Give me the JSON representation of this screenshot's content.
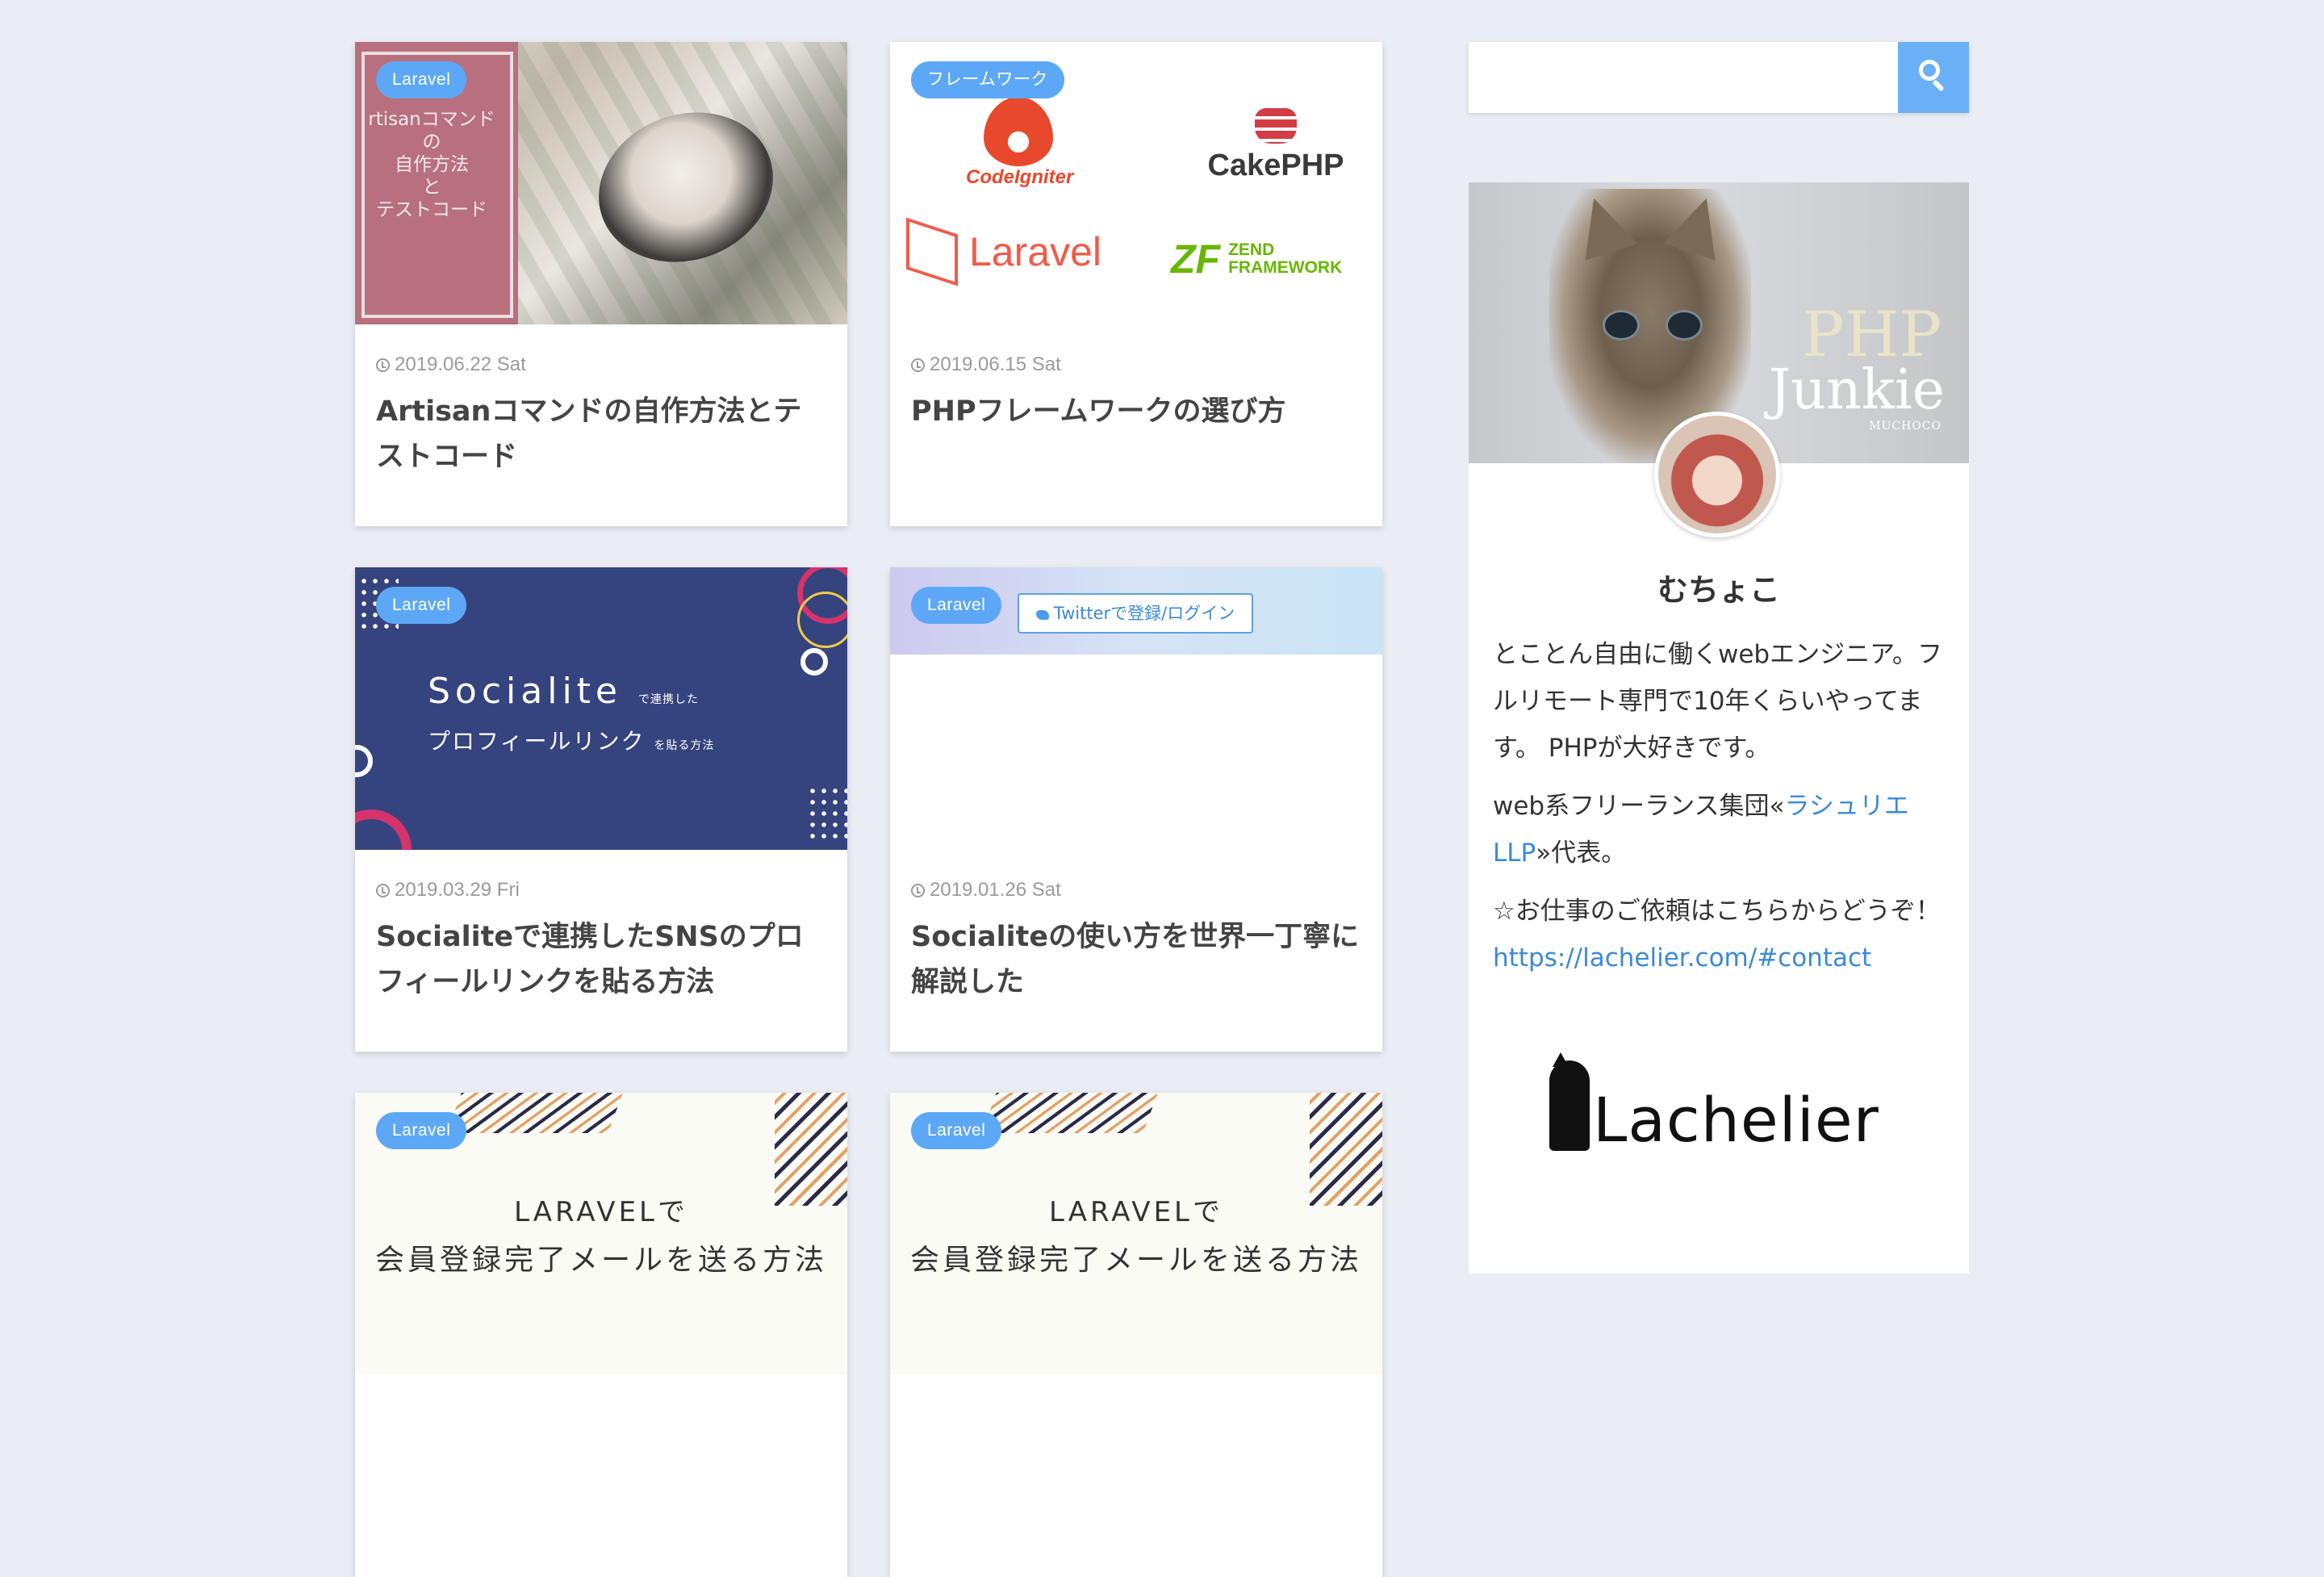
{
  "cards": [
    {
      "category": "Laravel",
      "date": "2019.06.22 Sat",
      "title": "Artisanコマンドの自作方法とテストコード",
      "thumb_text": "rtisanコマンド\nの\n自作方法\nと\nテストコード"
    },
    {
      "category": "フレームワーク",
      "date": "2019.06.15 Sat",
      "title": "PHPフレームワークの選び方",
      "logos": {
        "codeigniter": "CodeIgniter",
        "cakephp": "CakePHP",
        "laravel": "Laravel",
        "zend_mark": "ZF",
        "zend_line1": "ZEND",
        "zend_line2": "FRAMEWORK"
      }
    },
    {
      "category": "Laravel",
      "date": "2019.03.29 Fri",
      "title": "Socialiteで連携したSNSのプロフィールリンクを貼る方法",
      "thumb_line1": "Socialite",
      "thumb_line1_small": "で連携した",
      "thumb_line2": "プロフィールリンク",
      "thumb_line2_small": "を貼る方法"
    },
    {
      "category": "Laravel",
      "date": "2019.01.26 Sat",
      "title": "Socialiteの使い方を世界一丁寧に解説した",
      "twitter_button": "Twitterで登録/ログイン"
    },
    {
      "category": "Laravel",
      "thumb_line1": "LARAVELで",
      "thumb_line2": "会員登録完了メールを送る方法"
    },
    {
      "category": "Laravel",
      "thumb_line1": "LARAVELで",
      "thumb_line2": "会員登録完了メールを送る方法"
    }
  ],
  "sidebar": {
    "search": {
      "value": "",
      "placeholder": ""
    },
    "banner": {
      "line1": "PHP",
      "line2": "Junkie",
      "line3": "MUCHOCO"
    },
    "profile_name": "むちょこ",
    "bio_line1": "とことん自由に働くwebエンジニア。フルリモート専門で10年くらいやってます。 PHPが大好きです。",
    "bio_line2_pre": "web系フリーランス集団«",
    "bio_link_text": "ラシュリエLLP",
    "bio_line2_post": "»代表。",
    "bio_line3_pre": "☆お仕事のご依頼はこちらからどうぞ！ ",
    "bio_contact_link": "https://lachelier.com/#contact",
    "logo_text": "achelier"
  },
  "colors": {
    "background": "#eaedf4",
    "badge": "#5da8f6",
    "link": "#3a8ad8",
    "search_button": "#6ab0f6"
  },
  "icons": [
    "clock-icon",
    "search-icon",
    "twitter-bird-icon"
  ]
}
